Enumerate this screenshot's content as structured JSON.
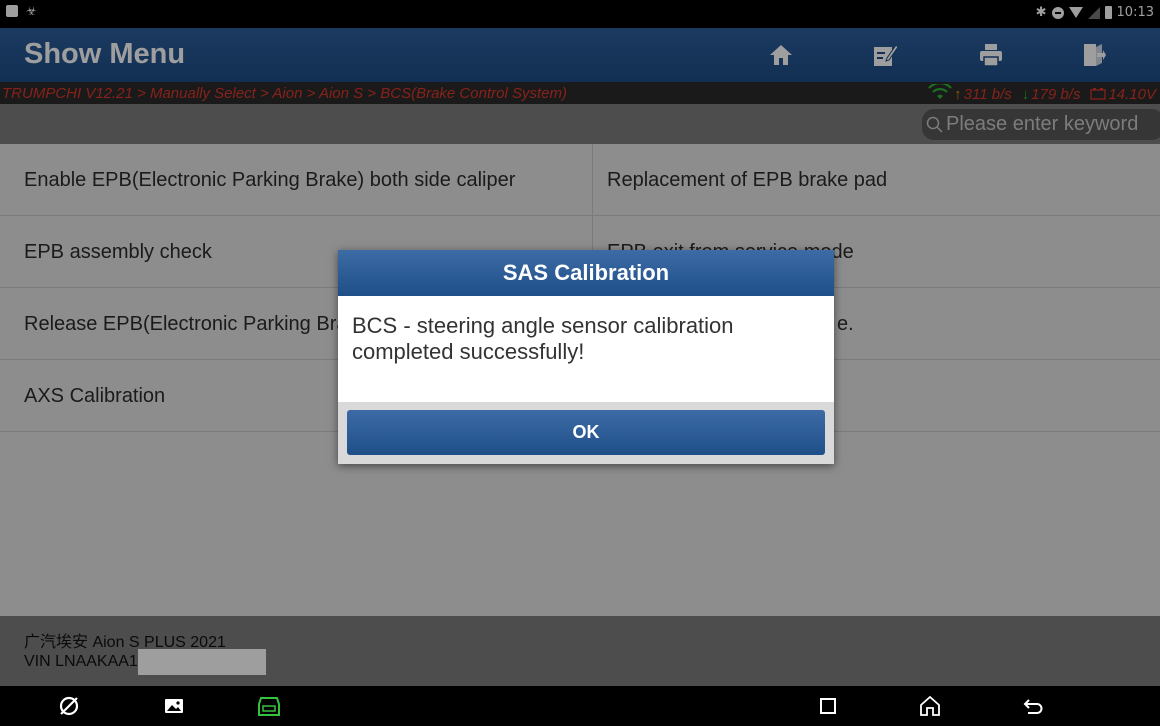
{
  "status_bar": {
    "time": "10:13"
  },
  "header": {
    "title": "Show Menu",
    "icons": [
      "home-icon",
      "edit-icon",
      "print-icon",
      "exit-icon"
    ]
  },
  "breadcrumb": {
    "path": "TRUMPCHI V12.21 > Manually Select > Aion > Aion S > BCS(Brake Control System)",
    "upload": "311 b/s",
    "download": "179 b/s",
    "voltage": "14.10V"
  },
  "search": {
    "placeholder": "Please enter keyword"
  },
  "menu": {
    "rows": [
      {
        "left": "Enable EPB(Electronic Parking Brake) both side caliper",
        "right": "Replacement of EPB brake pad"
      },
      {
        "left": "EPB assembly check",
        "right": "EPB exit from service mode"
      },
      {
        "left": "Release EPB(Electronic Parking Brake) both side caliper",
        "right": "e."
      },
      {
        "left": "AXS Calibration",
        "right": ""
      }
    ]
  },
  "footer": {
    "vehicle": "广汽埃安 Aion S PLUS 2021",
    "vin_label": "VIN LNAAKAA1"
  },
  "dialog": {
    "title": "SAS Calibration",
    "message": "BCS - steering angle sensor calibration completed successfully!",
    "ok_label": "OK"
  },
  "colors": {
    "header_blue": "#1d4d86",
    "breadcrumb_red": "#d9382c",
    "wifi_green": "#2fb536",
    "arrow_orange": "#e58a16"
  }
}
